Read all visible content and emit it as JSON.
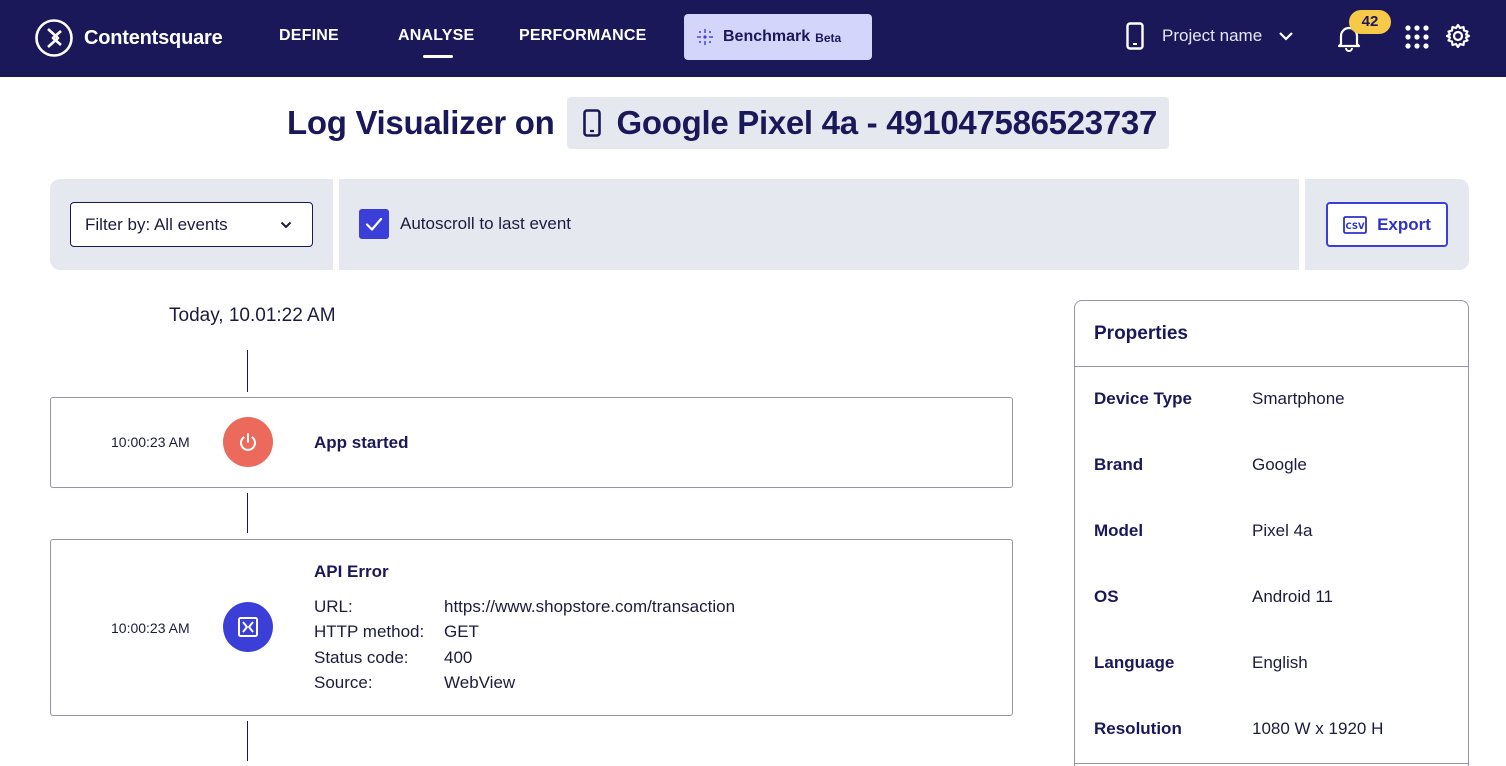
{
  "nav": {
    "brand": "Contentsquare",
    "links": [
      "DEFINE",
      "ANALYSE",
      "PERFORMANCE"
    ],
    "active_link": "ANALYSE",
    "benchmark": {
      "label": "Benchmark",
      "badge": "Beta"
    },
    "project": {
      "name": "Project name",
      "icon": "smartphone-icon"
    },
    "notifications_count": "42",
    "icons": [
      "bell-icon",
      "apps-grid-icon",
      "gear-icon"
    ],
    "colors": {
      "background": "#1a1859",
      "benchmark_bg": "#d4d5fb",
      "badge": "#f7c948"
    }
  },
  "page": {
    "title_prefix": "Log Visualizer on",
    "device": "Google Pixel 4a - 491047586523737"
  },
  "toolbar": {
    "filter_label": "Filter by: All events",
    "autoscroll_label": "Autoscroll to last event",
    "autoscroll_checked": true,
    "export_label": "Export",
    "accent": "#3b3fd8"
  },
  "timeline": {
    "date": "Today, 10.01:22 AM",
    "events": [
      {
        "time": "10:00:23 AM",
        "title": "App started",
        "icon": "power-icon",
        "color": "#ec6a5c"
      },
      {
        "time": "10:00:23 AM",
        "title": "API Error",
        "icon": "api-error-icon",
        "color": "#3b3fd8",
        "details": [
          {
            "key": "URL:",
            "value": "https://www.shopstore.com/transaction"
          },
          {
            "key": "HTTP method:",
            "value": "GET"
          },
          {
            "key": "Status code:",
            "value": "400"
          },
          {
            "key": "Source:",
            "value": "WebView"
          }
        ]
      }
    ]
  },
  "properties": {
    "title": "Properties",
    "rows": [
      {
        "key": "Device Type",
        "value": "Smartphone"
      },
      {
        "key": "Brand",
        "value": "Google"
      },
      {
        "key": "Model",
        "value": "Pixel 4a"
      },
      {
        "key": "OS",
        "value": "Android 11"
      },
      {
        "key": "Language",
        "value": "English"
      },
      {
        "key": "Resolution",
        "value": "1080 W x 1920 H"
      }
    ]
  }
}
